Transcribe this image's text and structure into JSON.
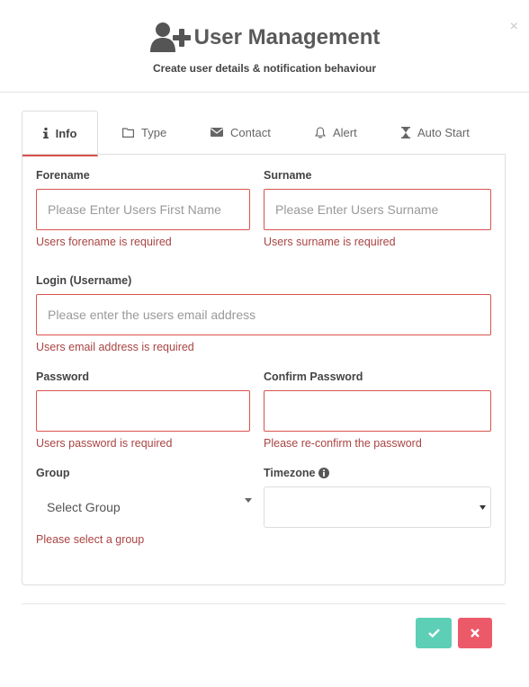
{
  "header": {
    "title": "User Management",
    "subtitle": "Create user details & notification behaviour",
    "close_label": "×"
  },
  "tabs": [
    {
      "label": "Info",
      "icon": "info-icon",
      "active": true
    },
    {
      "label": "Type",
      "icon": "folder-icon"
    },
    {
      "label": "Contact",
      "icon": "envelope-icon"
    },
    {
      "label": "Alert",
      "icon": "bell-icon"
    },
    {
      "label": "Auto Start",
      "icon": "hourglass-icon"
    }
  ],
  "form": {
    "forename": {
      "label": "Forename",
      "placeholder": "Please Enter Users First Name",
      "error": "Users forename is required"
    },
    "surname": {
      "label": "Surname",
      "placeholder": "Please Enter Users Surname",
      "error": "Users surname is required"
    },
    "login": {
      "label": "Login (Username)",
      "placeholder": "Please enter the users email address",
      "error": "Users email address is required"
    },
    "password": {
      "label": "Password",
      "error": "Users password is required"
    },
    "confirm_password": {
      "label": "Confirm Password",
      "error": "Please re-confirm the password"
    },
    "group": {
      "label": "Group",
      "selected": "Select Group",
      "error": "Please select a group"
    },
    "timezone": {
      "label": "Timezone",
      "selected": ""
    }
  },
  "buttons": {
    "confirm_color": "#5dcfb6",
    "cancel_color": "#ec5a6a"
  },
  "colors": {
    "error": "#a94442",
    "error_border": "#d9534f"
  }
}
